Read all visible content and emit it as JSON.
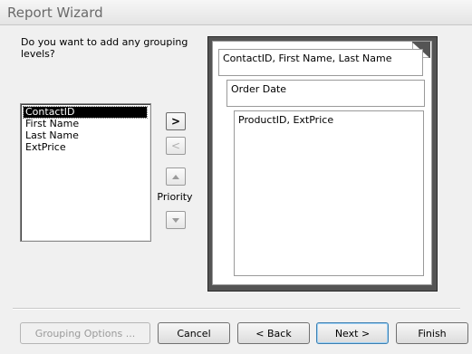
{
  "window": {
    "title": "Report Wizard"
  },
  "prompt": "Do you want to add any grouping levels?",
  "fields": {
    "items": [
      {
        "label": "ContactID",
        "selected": true
      },
      {
        "label": "First Name",
        "selected": false
      },
      {
        "label": "Last Name",
        "selected": false
      },
      {
        "label": "ExtPrice",
        "selected": false
      }
    ]
  },
  "move_buttons": {
    "add_label": ">",
    "remove_label": "<",
    "up_icon": "arrow-up-icon",
    "down_icon": "arrow-down-icon",
    "priority_label": "Priority"
  },
  "preview": {
    "level1": "ContactID, First Name, Last Name",
    "level2": "Order Date",
    "detail": "ProductID, ExtPrice"
  },
  "footer": {
    "grouping_options": "Grouping Options ...",
    "cancel": "Cancel",
    "back": "< Back",
    "next": "Next >",
    "finish": "Finish"
  }
}
